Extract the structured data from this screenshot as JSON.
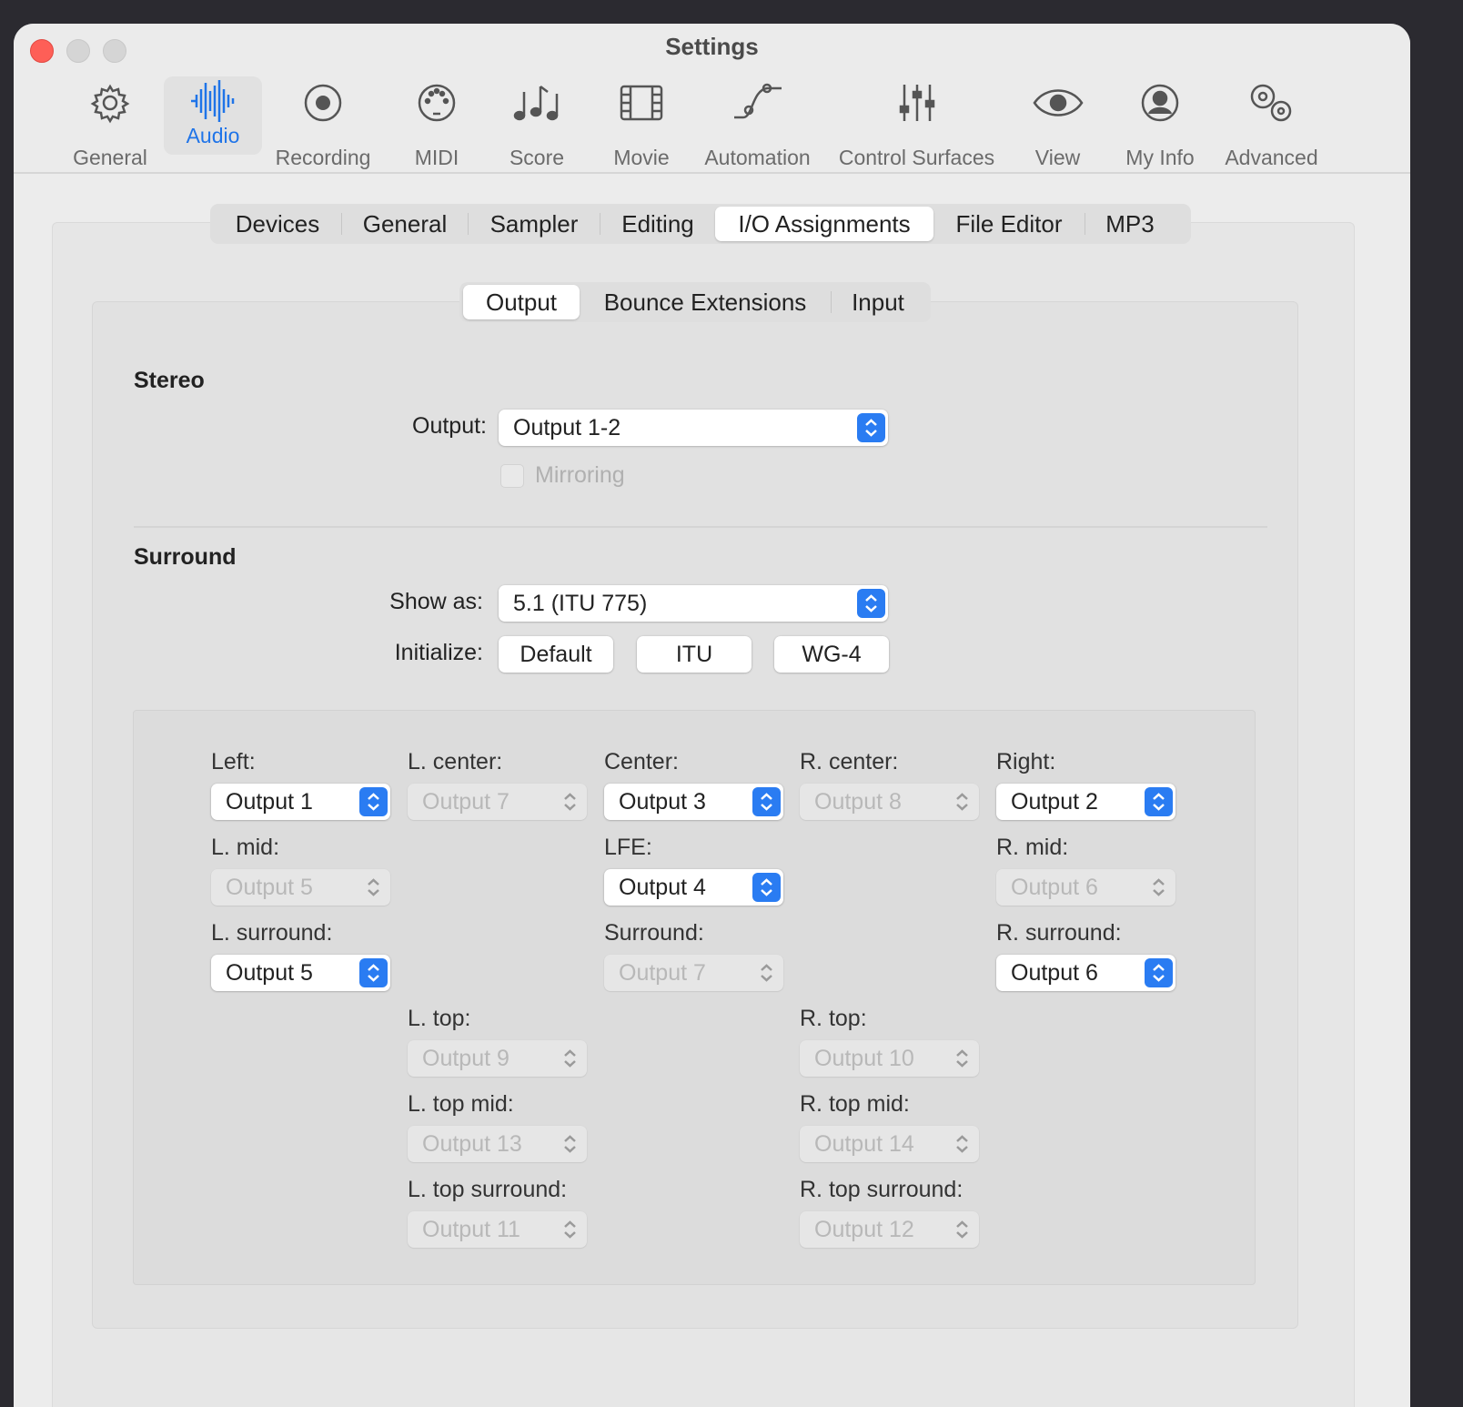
{
  "window": {
    "title": "Settings"
  },
  "toolbar": {
    "items": [
      {
        "label": "General",
        "icon": "gear-icon"
      },
      {
        "label": "Audio",
        "icon": "waveform-icon"
      },
      {
        "label": "Recording",
        "icon": "record-icon"
      },
      {
        "label": "MIDI",
        "icon": "midi-port-icon"
      },
      {
        "label": "Score",
        "icon": "music-notes-icon"
      },
      {
        "label": "Movie",
        "icon": "film-icon"
      },
      {
        "label": "Automation",
        "icon": "automation-curve-icon"
      },
      {
        "label": "Control Surfaces",
        "icon": "sliders-icon"
      },
      {
        "label": "View",
        "icon": "eye-icon"
      },
      {
        "label": "My Info",
        "icon": "person-icon"
      },
      {
        "label": "Advanced",
        "icon": "gears-icon"
      }
    ],
    "selected": "Audio"
  },
  "tabs": {
    "items": [
      "Devices",
      "General",
      "Sampler",
      "Editing",
      "I/O Assignments",
      "File Editor",
      "MP3"
    ],
    "selected": "I/O Assignments"
  },
  "subtabs": {
    "items": [
      "Output",
      "Bounce Extensions",
      "Input"
    ],
    "selected": "Output"
  },
  "stereo": {
    "heading": "Stereo",
    "output_label": "Output:",
    "output_value": "Output 1-2",
    "mirroring_label": "Mirroring"
  },
  "surround": {
    "heading": "Surround",
    "show_as_label": "Show as:",
    "show_as_value": "5.1 (ITU 775)",
    "initialize_label": "Initialize:",
    "buttons": [
      "Default",
      "ITU",
      "WG-4"
    ],
    "channels": {
      "left": {
        "label": "Left:",
        "value": "Output 1"
      },
      "l_center": {
        "label": "L. center:",
        "value": "Output 7"
      },
      "center": {
        "label": "Center:",
        "value": "Output 3"
      },
      "r_center": {
        "label": "R. center:",
        "value": "Output 8"
      },
      "right": {
        "label": "Right:",
        "value": "Output 2"
      },
      "l_mid": {
        "label": "L. mid:",
        "value": "Output 5"
      },
      "lfe": {
        "label": "LFE:",
        "value": "Output 4"
      },
      "r_mid": {
        "label": "R. mid:",
        "value": "Output 6"
      },
      "l_surround": {
        "label": "L. surround:",
        "value": "Output 5"
      },
      "surround": {
        "label": "Surround:",
        "value": "Output 7"
      },
      "r_surround": {
        "label": "R. surround:",
        "value": "Output 6"
      },
      "l_top": {
        "label": "L. top:",
        "value": "Output 9"
      },
      "r_top": {
        "label": "R. top:",
        "value": "Output 10"
      },
      "l_top_mid": {
        "label": "L. top mid:",
        "value": "Output 13"
      },
      "r_top_mid": {
        "label": "R. top mid:",
        "value": "Output 14"
      },
      "l_top_surround": {
        "label": "L. top surround:",
        "value": "Output 11"
      },
      "r_top_surround": {
        "label": "R. top surround:",
        "value": "Output 12"
      }
    }
  },
  "colors": {
    "accent": "#1f74e8",
    "close": "#fe5f57"
  }
}
